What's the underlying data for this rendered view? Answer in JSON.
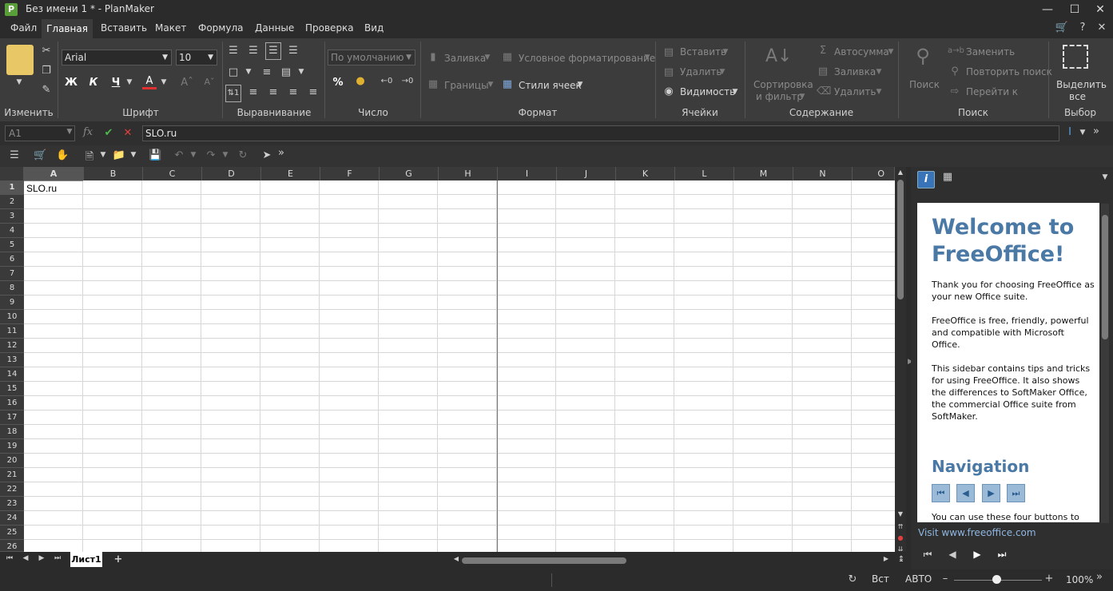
{
  "window": {
    "title": "Без имени 1 * - PlanMaker",
    "app_icon": "P"
  },
  "menu": [
    "Файл",
    "Главная",
    "Вставить",
    "Макет",
    "Формула",
    "Данные",
    "Проверка",
    "Вид"
  ],
  "ribbon": {
    "groups": [
      "Изменить",
      "Шрифт",
      "Выравнивание",
      "Число",
      "Формат",
      "Ячейки",
      "Содержание",
      "Поиск",
      "Выбор"
    ],
    "font_name": "Arial",
    "font_size": "10",
    "bold": "Ж",
    "italic": "К",
    "underline": "Ч",
    "font_color": "A",
    "number_format": "По умолчанию",
    "percent": "%",
    "format": {
      "fill": "Заливка",
      "conditional": "Условное форматирование",
      "borders": "Границы",
      "cell_styles": "Стили ячеек"
    },
    "cells": {
      "insert": "Вставить",
      "delete": "Удалить",
      "visibility": "Видимость"
    },
    "content": {
      "sort_filter_1": "Сортировка",
      "sort_filter_2": "и фильтр",
      "autosum": "Автосумма",
      "fill": "Заливка",
      "delete": "Удалить"
    },
    "search": {
      "search": "Поиск",
      "replace": "Заменить",
      "repeat": "Повторить поиск",
      "goto": "Перейти к"
    },
    "select": {
      "label_1": "Выделить",
      "label_2": "все"
    }
  },
  "formula_bar": {
    "name_box": "A1",
    "fx": "fx",
    "content": "SLO.ru"
  },
  "columns": [
    "A",
    "B",
    "C",
    "D",
    "E",
    "F",
    "G",
    "H",
    "I",
    "J",
    "K",
    "L",
    "M",
    "N",
    "O"
  ],
  "rows": [
    "1",
    "2",
    "3",
    "4",
    "5",
    "6",
    "7",
    "8",
    "9",
    "10",
    "11",
    "12",
    "13",
    "14",
    "15",
    "16",
    "17",
    "18",
    "19",
    "20",
    "21",
    "22",
    "23",
    "24",
    "25",
    "26"
  ],
  "cells": {
    "A1": "SLO.ru"
  },
  "sheet_tabs": [
    "Лист1"
  ],
  "sidebar": {
    "title": "Welcome to FreeOffice!",
    "p1": "Thank you for choosing FreeOffice as your new Office suite.",
    "p2": "FreeOffice is free, friendly, powerful and compatible with Microsoft Office.",
    "p3": "This sidebar contains tips and tricks for using FreeOffice. It also shows the differences to SoftMaker Office, the commercial Office suite from SoftMaker.",
    "nav_title": "Navigation",
    "p4": "You can use these four buttons to",
    "link": "Visit www.freeoffice.com"
  },
  "status": {
    "mode": "Вст",
    "calc": "АВТО",
    "zoom": "100%"
  }
}
